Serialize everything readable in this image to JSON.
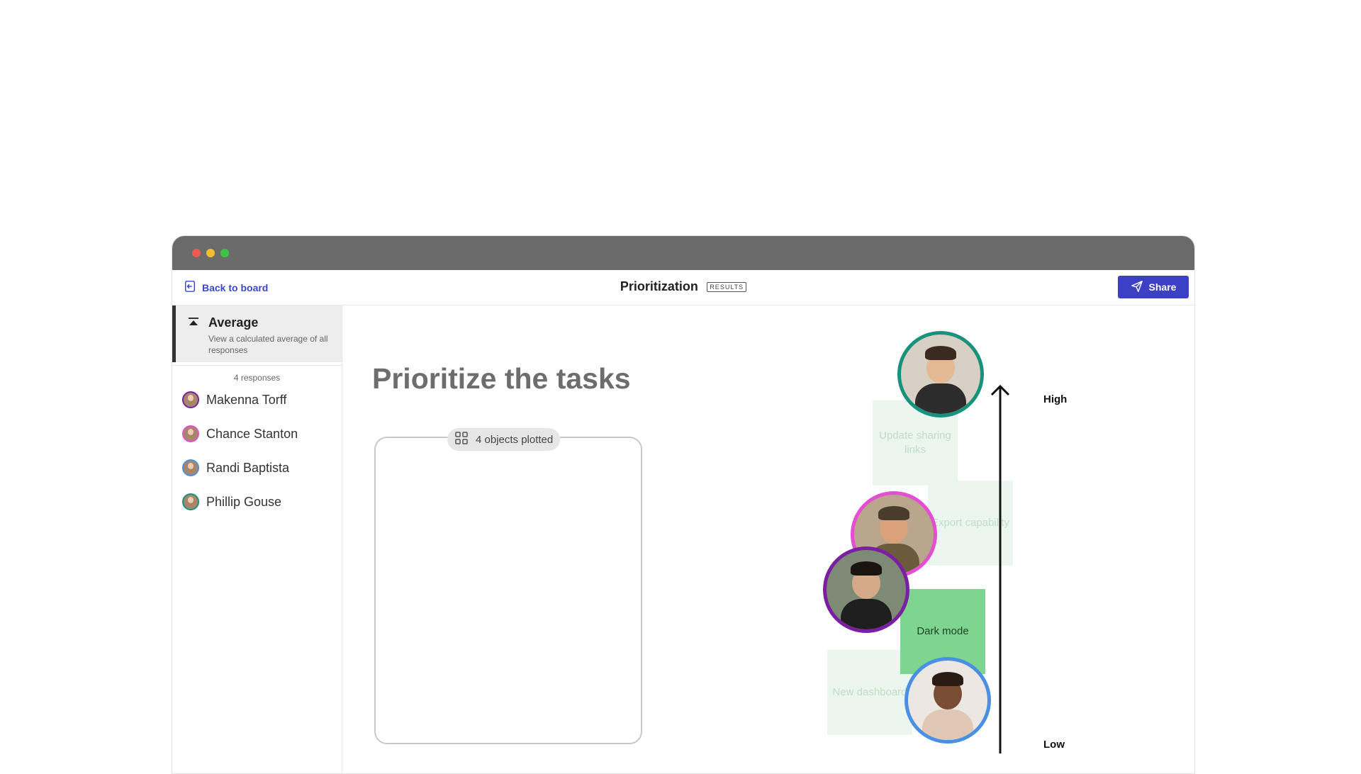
{
  "toolbar": {
    "back_label": "Back to board",
    "title": "Prioritization",
    "badge": "RESULTS",
    "share_label": "Share"
  },
  "sidebar": {
    "average": {
      "title": "Average",
      "subtitle": "View a calculated average of all responses"
    },
    "responses_label": "4 responses",
    "people": [
      {
        "name": "Makenna Torff",
        "ring": "#7a1fa2"
      },
      {
        "name": "Chance Stanton",
        "ring": "#e44fd2"
      },
      {
        "name": "Randi Baptista",
        "ring": "#4a90e2"
      },
      {
        "name": "Phillip Gouse",
        "ring": "#17937d"
      }
    ]
  },
  "main": {
    "heading": "Prioritize the tasks",
    "plotted_label": "4 objects plotted",
    "notes": [
      {
        "label": "Update sharing links"
      },
      {
        "label": "Export capability"
      },
      {
        "label": "Dark mode"
      },
      {
        "label": "New dashboard"
      }
    ],
    "axis": {
      "high": "High",
      "low": "Low"
    }
  },
  "colors": {
    "accent": "#3b40c4",
    "link": "#3a47c7",
    "note_active": "#7dd58f",
    "note_faint": "#ebf7ee"
  },
  "icons": [
    "back-icon",
    "send-icon",
    "average-icon",
    "grid-icon",
    "arrow-up-icon"
  ]
}
